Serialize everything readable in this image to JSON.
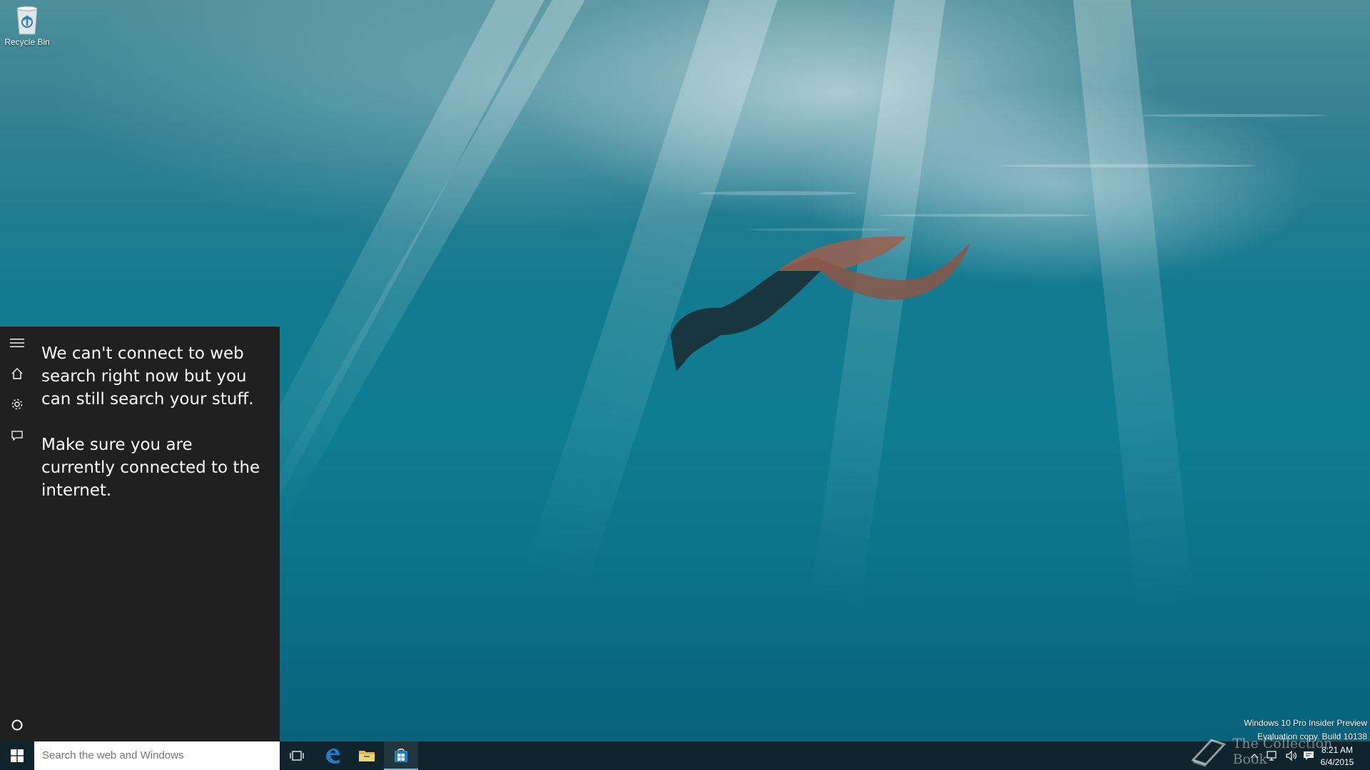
{
  "desktop": {
    "icons": [
      {
        "label": "Recycle Bin",
        "icon": "recycle-bin-icon"
      }
    ]
  },
  "cortana": {
    "rail": [
      {
        "name": "menu",
        "icon": "hamburger-menu-icon"
      },
      {
        "name": "home",
        "icon": "home-icon"
      },
      {
        "name": "notebook-settings",
        "icon": "gear-icon"
      },
      {
        "name": "feedback",
        "icon": "feedback-icon"
      }
    ],
    "messages": [
      "We can't connect to web search right now but you can still search your stuff.",
      "Make sure you are currently connected to the internet."
    ],
    "cortana_icon": "cortana-circle-icon"
  },
  "taskbar": {
    "start_icon": "windows-logo-icon",
    "search": {
      "placeholder": "Search the web and Windows",
      "value": ""
    },
    "apps": [
      {
        "name": "task-view",
        "icon": "task-view-icon"
      },
      {
        "name": "edge",
        "icon": "edge-browser-icon"
      },
      {
        "name": "file-explorer",
        "icon": "folder-icon"
      },
      {
        "name": "store",
        "icon": "store-icon",
        "active": true
      }
    ],
    "tray": {
      "icons": [
        "chevron-up-icon",
        "network-icon",
        "volume-icon",
        "action-center-icon"
      ],
      "time": "8:21 AM",
      "date": "6/4/2015"
    }
  },
  "watermark": {
    "line1": "Windows 10 Pro Insider Preview",
    "line2": "Evaluation copy. Build 10138",
    "site": "The Collection Book"
  },
  "colors": {
    "cortana_bg": "#202020",
    "taskbar_bg": "#102026",
    "accent": "#1e7fc8",
    "search_bg": "#ffffff",
    "search_text": "#6d6d6d"
  }
}
